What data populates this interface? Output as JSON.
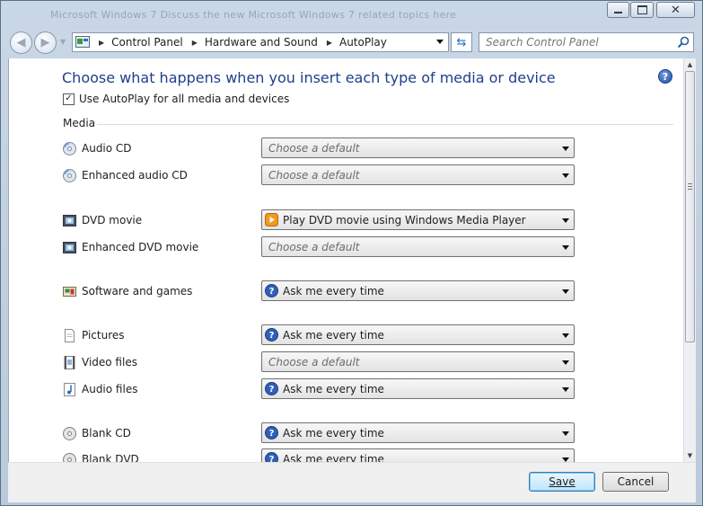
{
  "window": {
    "title": "Microsoft Windows 7 Discuss the new Microsoft Windows 7 related topics here"
  },
  "address": {
    "crumbs": [
      "Control Panel",
      "Hardware and Sound",
      "AutoPlay"
    ]
  },
  "search": {
    "placeholder": "Search Control Panel"
  },
  "page": {
    "heading": "Choose what happens when you insert each type of media or device",
    "autoplay_checkbox": {
      "label": "Use AutoPlay for all media and devices",
      "checked": true
    },
    "section_media": "Media"
  },
  "rows": [
    {
      "label": "Audio CD",
      "value": "Choose a default",
      "placeholder": true,
      "icon": "cd-icon",
      "option_icon": null
    },
    {
      "label": "Enhanced audio CD",
      "value": "Choose a default",
      "placeholder": true,
      "icon": "cd-icon",
      "option_icon": null
    },
    {
      "label": "DVD movie",
      "value": "Play DVD movie using Windows Media Player",
      "placeholder": false,
      "icon": "dvd-movie-icon",
      "option_icon": "media-player-icon"
    },
    {
      "label": "Enhanced DVD movie",
      "value": "Choose a default",
      "placeholder": true,
      "icon": "dvd-movie-icon",
      "option_icon": null
    },
    {
      "label": "Software and games",
      "value": "Ask me every time",
      "placeholder": false,
      "icon": "software-icon",
      "option_icon": "question-icon"
    },
    {
      "label": "Pictures",
      "value": "Ask me every time",
      "placeholder": false,
      "icon": "picture-file-icon",
      "option_icon": "question-icon"
    },
    {
      "label": "Video files",
      "value": "Choose a default",
      "placeholder": true,
      "icon": "video-file-icon",
      "option_icon": null
    },
    {
      "label": "Audio files",
      "value": "Ask me every time",
      "placeholder": false,
      "icon": "audio-file-icon",
      "option_icon": "question-icon"
    },
    {
      "label": "Blank CD",
      "value": "Ask me every time",
      "placeholder": false,
      "icon": "blank-cd-icon",
      "option_icon": "question-icon"
    },
    {
      "label": "Blank DVD",
      "value": "Ask me every time",
      "placeholder": false,
      "icon": "blank-cd-icon",
      "option_icon": "question-icon"
    }
  ],
  "footer": {
    "save_label": "Save",
    "cancel_label": "Cancel"
  },
  "colors": {
    "heading": "#1f3f8c",
    "placeholder_text": "#6d6d6d",
    "primary_button": "#bee6fd"
  }
}
